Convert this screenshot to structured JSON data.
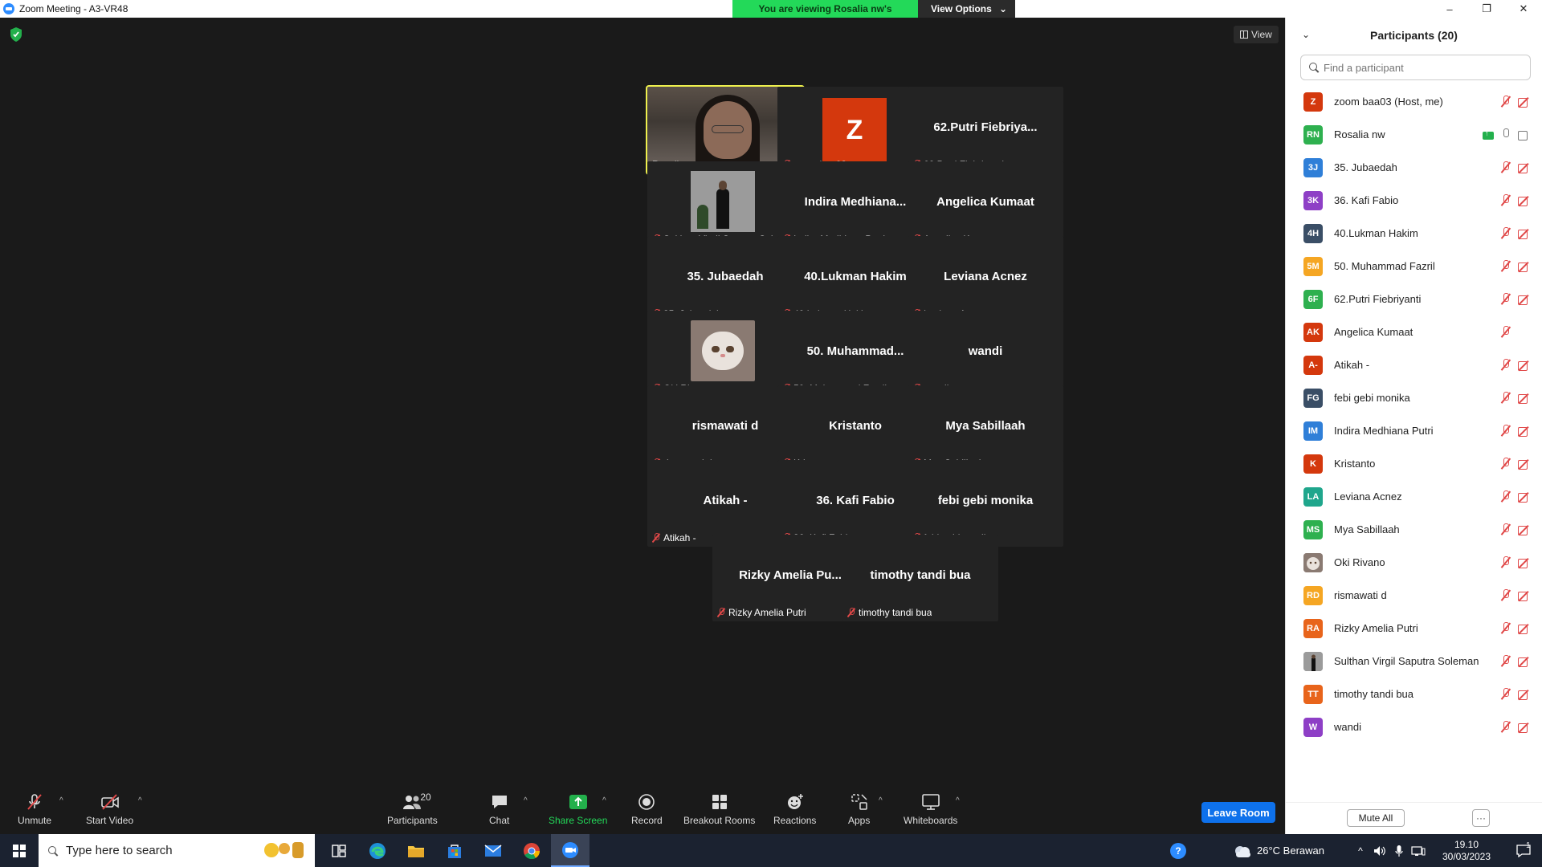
{
  "window": {
    "title": "Zoom Meeting - A3-VR48",
    "banner_text": "You are viewing Rosalia nw's screen",
    "view_options_label": "View Options",
    "controls": [
      "–",
      "❐",
      "✕"
    ]
  },
  "meeting": {
    "view_label": "View",
    "tiles": [
      {
        "name": "Rosalia nw",
        "center": "",
        "kind": "video",
        "muted": false,
        "active": true
      },
      {
        "name": "zoom baa03",
        "center": "Z",
        "kind": "avatar",
        "muted": true
      },
      {
        "name": "62.Putri Fiebriyanti",
        "center": "62.Putri  Fiebriya...",
        "kind": "name",
        "muted": true
      },
      {
        "name": "Sulthan Virgil Saputra Sole...",
        "center": "",
        "kind": "sulthan",
        "muted": true
      },
      {
        "name": "Indira Medhiana Putri",
        "center": "Indira  Medhiana...",
        "kind": "name",
        "muted": true
      },
      {
        "name": "Angelica Kumaat",
        "center": "Angelica Kumaat",
        "kind": "name",
        "muted": true
      },
      {
        "name": "35. Jubaedah",
        "center": "35. Jubaedah",
        "kind": "name",
        "muted": true
      },
      {
        "name": "40.Lukman Hakim",
        "center": "40.Lukman Hakim",
        "kind": "name",
        "muted": true
      },
      {
        "name": "Leviana Acnez",
        "center": "Leviana Acnez",
        "kind": "name",
        "muted": true
      },
      {
        "name": "Oki Rivano",
        "center": "",
        "kind": "cat",
        "muted": true
      },
      {
        "name": "50. Muhammad Fazril",
        "center": "50.  Muhammad...",
        "kind": "name",
        "muted": true
      },
      {
        "name": "wandi",
        "center": "wandi",
        "kind": "name",
        "muted": true
      },
      {
        "name": "rismawati d",
        "center": "rismawati d",
        "kind": "name",
        "muted": true
      },
      {
        "name": "Kristanto",
        "center": "Kristanto",
        "kind": "name",
        "muted": true
      },
      {
        "name": "Mya Sabillaah",
        "center": "Mya Sabillaah",
        "kind": "name",
        "muted": true
      },
      {
        "name": "Atikah -",
        "center": "Atikah -",
        "kind": "name",
        "muted": true
      },
      {
        "name": "36. Kafi Fabio",
        "center": "36. Kafi Fabio",
        "kind": "name",
        "muted": true
      },
      {
        "name": "febi gebi monika",
        "center": "febi gebi monika",
        "kind": "name",
        "muted": true
      },
      {
        "name": "Rizky Amelia Putri",
        "center": "Rizky  Amelia  Pu...",
        "kind": "name",
        "muted": true
      },
      {
        "name": "timothy tandi bua",
        "center": "timothy tandi bua",
        "kind": "name",
        "muted": true
      }
    ]
  },
  "toolbar": {
    "unmute": "Unmute",
    "start_video": "Start Video",
    "participants": "Participants",
    "participants_count": "20",
    "chat": "Chat",
    "share_screen": "Share Screen",
    "record": "Record",
    "breakout_rooms": "Breakout Rooms",
    "reactions": "Reactions",
    "apps": "Apps",
    "whiteboards": "Whiteboards",
    "leave_room": "Leave Room"
  },
  "panel": {
    "title": "Participants (20)",
    "search_placeholder": "Find a participant",
    "mute_all": "Mute All",
    "more": "···",
    "participants": [
      {
        "initials": "Z",
        "name": "zoom baa03 (Host, me)",
        "color": "#d4380d",
        "mic": "muted",
        "cam": "off"
      },
      {
        "initials": "RN",
        "name": "Rosalia nw",
        "color": "#2eb04f",
        "mic": "on",
        "cam": "on",
        "sharing": true
      },
      {
        "initials": "3J",
        "name": "35. Jubaedah",
        "color": "#2f7fd8",
        "mic": "muted",
        "cam": "off"
      },
      {
        "initials": "3K",
        "name": "36. Kafi Fabio",
        "color": "#8e3fc6",
        "mic": "muted",
        "cam": "off"
      },
      {
        "initials": "4H",
        "name": "40.Lukman Hakim",
        "color": "#3a4e66",
        "mic": "muted",
        "cam": "off"
      },
      {
        "initials": "5M",
        "name": "50. Muhammad Fazril",
        "color": "#f5a623",
        "mic": "muted",
        "cam": "off"
      },
      {
        "initials": "6F",
        "name": "62.Putri Fiebriyanti",
        "color": "#2eb04f",
        "mic": "muted",
        "cam": "off"
      },
      {
        "initials": "AK",
        "name": "Angelica Kumaat",
        "color": "#d4380d",
        "mic": "muted",
        "cam": "none"
      },
      {
        "initials": "A-",
        "name": "Atikah -",
        "color": "#d4380d",
        "mic": "muted",
        "cam": "off"
      },
      {
        "initials": "FG",
        "name": "febi gebi monika",
        "color": "#3a4e66",
        "mic": "muted",
        "cam": "off"
      },
      {
        "initials": "IM",
        "name": "Indira Medhiana Putri",
        "color": "#2f7fd8",
        "mic": "muted",
        "cam": "off"
      },
      {
        "initials": "K",
        "name": "Kristanto",
        "color": "#d4380d",
        "mic": "muted",
        "cam": "off"
      },
      {
        "initials": "LA",
        "name": "Leviana Acnez",
        "color": "#1fa68c",
        "mic": "muted",
        "cam": "off"
      },
      {
        "initials": "MS",
        "name": "Mya Sabillaah",
        "color": "#2eb04f",
        "mic": "muted",
        "cam": "off"
      },
      {
        "initials": "",
        "name": "Oki Rivano",
        "color": "#b9a89c",
        "mic": "muted",
        "cam": "off",
        "photo": "cat"
      },
      {
        "initials": "RD",
        "name": "rismawati d",
        "color": "#f5a623",
        "mic": "muted",
        "cam": "off"
      },
      {
        "initials": "RA",
        "name": "Rizky Amelia Putri",
        "color": "#e8641b",
        "mic": "muted",
        "cam": "off"
      },
      {
        "initials": "",
        "name": "Sulthan Virgil Saputra Soleman",
        "color": "#555555",
        "mic": "muted",
        "cam": "off",
        "photo": "person"
      },
      {
        "initials": "TT",
        "name": "timothy tandi bua",
        "color": "#e8641b",
        "mic": "muted",
        "cam": "off"
      },
      {
        "initials": "W",
        "name": "wandi",
        "color": "#8e3fc6",
        "mic": "muted",
        "cam": "off"
      }
    ]
  },
  "taskbar": {
    "search_placeholder": "Type here to search",
    "weather": "26°C  Berawan",
    "time": "19.10",
    "date": "30/03/2023",
    "notification_count": "1"
  }
}
